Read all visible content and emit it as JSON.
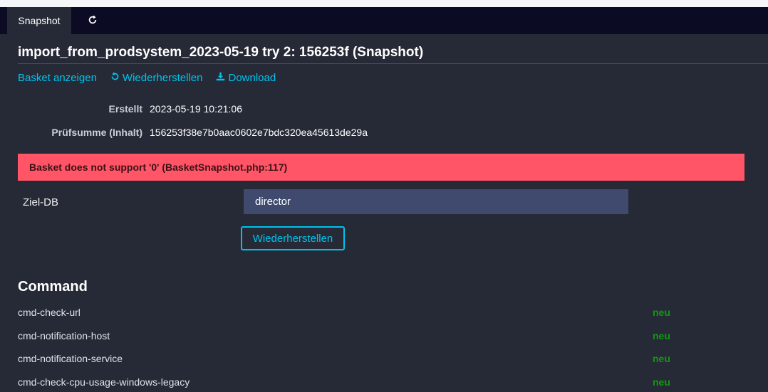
{
  "tabs": [
    {
      "label": "Snapshot",
      "active": true
    },
    {
      "icon": "refresh-icon"
    }
  ],
  "page": {
    "title": "import_from_prodsystem_2023-05-19 try 2: 156253f (Snapshot)"
  },
  "actions": {
    "show_basket": "Basket anzeigen",
    "restore": "Wiederherstellen",
    "restore_icon": "restore-icon",
    "download": "Download",
    "download_icon": "download-icon"
  },
  "details": {
    "created_label": "Erstellt",
    "created_value": "2023-05-19 10:21:06",
    "checksum_label": "Prüfsumme (Inhalt)",
    "checksum_value": "156253f38e7b0aac0602e7bdc320ea45613de29a"
  },
  "error": {
    "message": "Basket does not support '0' (BasketSnapshot.php:117)"
  },
  "form": {
    "target_db_label": "Ziel-DB",
    "target_db_value": "director",
    "submit_label": "Wiederherstellen"
  },
  "command_section": {
    "title": "Command",
    "items": [
      {
        "name": "cmd-check-url",
        "status": "neu"
      },
      {
        "name": "cmd-notification-host",
        "status": "neu"
      },
      {
        "name": "cmd-notification-service",
        "status": "neu"
      },
      {
        "name": "cmd-check-cpu-usage-windows-legacy",
        "status": "neu"
      }
    ]
  },
  "colors": {
    "background": "#262a36",
    "tabbar": "#0b0c24",
    "accent": "#00c3ed",
    "error": "#ff5566",
    "status_new": "#119911",
    "select_bg": "#3f4a6e"
  }
}
